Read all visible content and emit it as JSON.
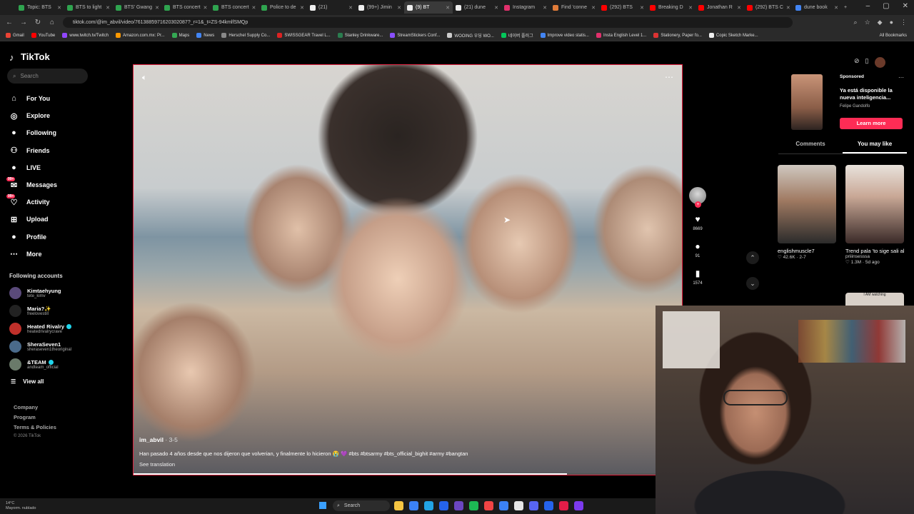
{
  "browser": {
    "tabs": [
      {
        "label": "Topic: BTS",
        "color": "#2fa44f"
      },
      {
        "label": "BTS to light",
        "color": "#2fa44f"
      },
      {
        "label": "BTS' Gwang",
        "color": "#2fa44f"
      },
      {
        "label": "BTS concert",
        "color": "#2fa44f"
      },
      {
        "label": "BTS concert",
        "color": "#2fa44f"
      },
      {
        "label": "Police to de",
        "color": "#2fa44f"
      },
      {
        "label": "(21)",
        "color": "#eeeeee"
      },
      {
        "label": "(99+) Jimin",
        "color": "#eeeeee"
      },
      {
        "label": "(9) BT",
        "color": "#eeeeee",
        "active": true
      },
      {
        "label": "(21) dune",
        "color": "#eeeeee"
      },
      {
        "label": "Instagram",
        "color": "#e1306c"
      },
      {
        "label": "Find 'conne",
        "color": "#e07b39"
      },
      {
        "label": "(292) BTS",
        "color": "#ff0000"
      },
      {
        "label": "Breaking D",
        "color": "#ff0000"
      },
      {
        "label": "Jonathan R",
        "color": "#ff0000"
      },
      {
        "label": "(292) BTS C",
        "color": "#ff0000"
      },
      {
        "label": "dune book",
        "color": "#4285f4"
      }
    ],
    "url": "tiktok.com/@im_abvil/video/7613885971620302087?_r=1&_t=ZS-94kmlfSMQp",
    "bookmarks": [
      {
        "label": "Gmail",
        "color": "#ea4335"
      },
      {
        "label": "YouTube",
        "color": "#ff0000"
      },
      {
        "label": "www.twitch.tv/Twitch",
        "color": "#9146ff"
      },
      {
        "label": "Amazon.com.mx: Pr...",
        "color": "#ff9900"
      },
      {
        "label": "Maps",
        "color": "#34a853"
      },
      {
        "label": "News",
        "color": "#4285f4"
      },
      {
        "label": "Herschel Supply Co...",
        "color": "#888888"
      },
      {
        "label": "SWISSGEAR Travel L...",
        "color": "#d22"
      },
      {
        "label": "Stanley Drinkware...",
        "color": "#2a7d4f"
      },
      {
        "label": "StreamStickers Conf...",
        "color": "#8a4fff"
      },
      {
        "label": "WOOING 우딩 WO...",
        "color": "#cccccc"
      },
      {
        "label": "네이버 플러그",
        "color": "#03c75a"
      },
      {
        "label": "Improve video statis...",
        "color": "#4285f4"
      },
      {
        "label": "Insta English Level 1...",
        "color": "#e1306c"
      },
      {
        "label": "Stationery, Paper fo...",
        "color": "#d33"
      },
      {
        "label": "Copic Sketch Marke...",
        "color": "#eeeeee"
      }
    ],
    "all_bookmarks": "All Bookmarks"
  },
  "sidebar": {
    "brand": "TikTok",
    "search_placeholder": "Search",
    "nav": [
      {
        "label": "For You",
        "icon": "home-icon"
      },
      {
        "label": "Explore",
        "icon": "compass-icon"
      },
      {
        "label": "Following",
        "icon": "following-icon"
      },
      {
        "label": "Friends",
        "icon": "friends-icon"
      },
      {
        "label": "LIVE",
        "icon": "live-icon"
      },
      {
        "label": "Messages",
        "icon": "messages-icon",
        "badge": "99+"
      },
      {
        "label": "Activity",
        "icon": "activity-icon",
        "badge": "99+"
      },
      {
        "label": "Upload",
        "icon": "upload-icon"
      },
      {
        "label": "Profile",
        "icon": "profile-icon"
      },
      {
        "label": "More",
        "icon": "more-icon"
      }
    ],
    "following_header": "Following accounts",
    "accounts": [
      {
        "name": "Kimtaehyung",
        "handle": "tete_kimv",
        "verified": false,
        "color": "#5a4a7a"
      },
      {
        "name": "Maria?✨",
        "handle": "freelovestill",
        "verified": false,
        "color": "#222222"
      },
      {
        "name": "Heated Rivalry",
        "handle": "heatedrivalrycrave",
        "verified": true,
        "color": "#c0302a"
      },
      {
        "name": "SheraSeven1",
        "handle": "sheraseven1theoriginal",
        "verified": false,
        "color": "#4a6a8a"
      },
      {
        "name": "&TEAM",
        "handle": "andteam_official",
        "verified": true,
        "color": "#6a7a6a"
      }
    ],
    "view_all": "View all",
    "footer": [
      "Company",
      "Program",
      "Terms & Policies"
    ],
    "copyright": "© 2026 TikTok"
  },
  "video": {
    "author": "im_abvil",
    "date": " · 3-5",
    "caption": "Han pasado 4 años desde que nos dijeron que volverian, y finalmente lo hicieron 😭 💜 #bts #btsarmy #bts_official_bighit #army #bangtan",
    "see_translation": "See translation",
    "progress": 0.79
  },
  "actions": {
    "likes": "8669",
    "comments": "91",
    "saves": "1574"
  },
  "right_panel": {
    "sponsored": "Sponsored",
    "ad_title": "Ya está disponible la nueva inteligencia...",
    "ad_author": "Felipe Gandolfo",
    "learn_more": "Learn more",
    "tabs": [
      "Comments",
      "You may like"
    ],
    "cards": [
      {
        "title": "englishmuscle7",
        "sub": "",
        "stats": "♡ 42.6K · 2-7"
      },
      {
        "title": "Trend pala 'to sige sali ako. 😂 🙏",
        "sub": "priiinsesssa",
        "stats": "♡ 1.3M · 5d ago"
      }
    ],
    "next_label": "I AM watching"
  },
  "taskbar": {
    "weather_temp": "14°C",
    "weather_desc": "Mayorm. nublado",
    "search": "Search",
    "apps": [
      "#f5c542",
      "#3b82f6",
      "#22a3e3",
      "#2563eb",
      "#6b46c1",
      "#1db954",
      "#ef4444",
      "#3b82f6",
      "#e5e5e5",
      "#5865f2",
      "#2563eb",
      "#e11d48",
      "#7c3aed"
    ]
  }
}
